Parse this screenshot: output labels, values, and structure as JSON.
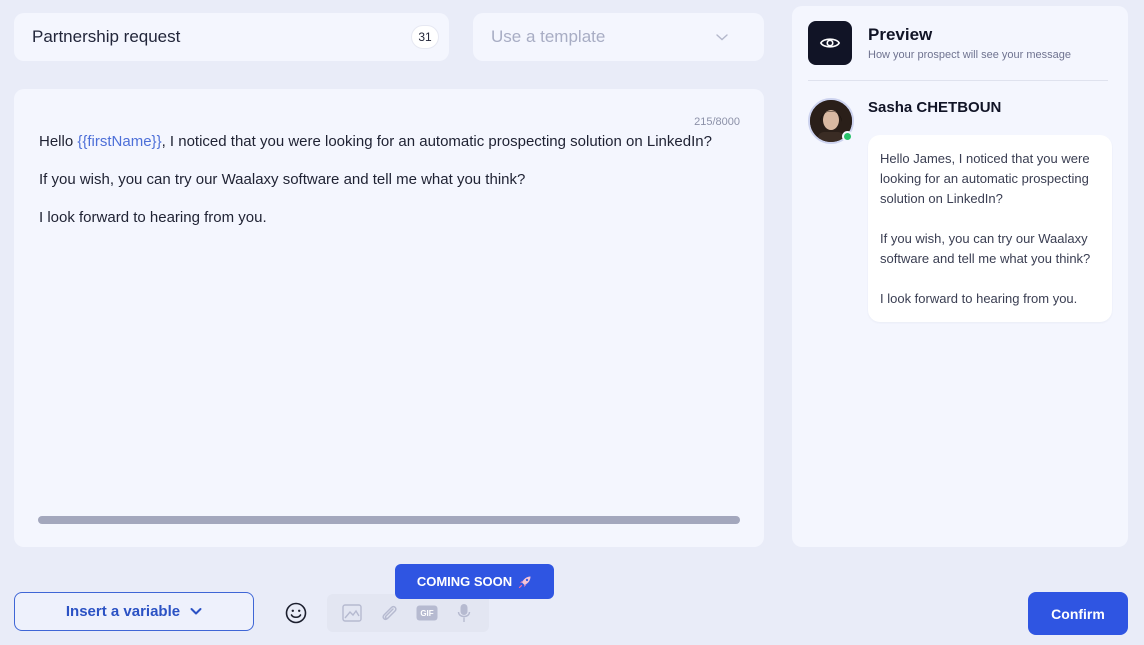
{
  "subject": {
    "value": "Partnership request",
    "count": "31"
  },
  "template": {
    "placeholder": "Use a template"
  },
  "editor": {
    "counter": "215/8000",
    "greeting_prefix": "Hello ",
    "variable": "{{firstName}}",
    "line1_rest": ", I noticed that you were looking for an automatic prospecting solution on LinkedIn?",
    "line2": "If you wish, you can try our Waalaxy software and tell me what you think?",
    "line3": "I look forward to hearing from you."
  },
  "preview": {
    "title": "Preview",
    "subtitle": "How your prospect will see your message",
    "sender_name": "Sasha CHETBOUN",
    "bubble": {
      "p1": "Hello James, I noticed that you were looking for an automatic prospecting solution on LinkedIn?",
      "p2": "If you wish, you can try our Waalaxy software and tell me what you think?",
      "p3": "I look forward to hearing from you."
    }
  },
  "toolbar": {
    "insert_variable_label": "Insert a variable",
    "coming_soon_label": "COMING SOON",
    "confirm_label": "Confirm",
    "icons": [
      "emoji-icon",
      "image-icon",
      "paperclip-icon",
      "gif-icon",
      "microphone-icon",
      "rocket-icon"
    ]
  },
  "colors": {
    "accent": "#2f55e2",
    "variable": "#4d6fd8",
    "online": "#27c26a",
    "dark": "#111426"
  }
}
